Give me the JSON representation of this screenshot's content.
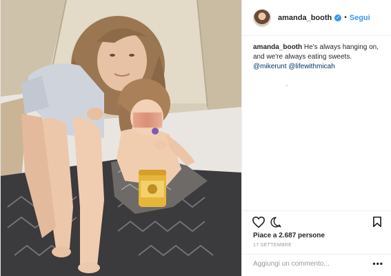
{
  "post": {
    "username": "amanda_booth",
    "follow_label": "Segui",
    "dot": "•",
    "verified_glyph": "✓",
    "caption": {
      "user": "amanda_booth",
      "text": "He's always hanging on, and we're always eating sweets.",
      "mentions": [
        "@mikerunt",
        "@lifewithmicah"
      ]
    },
    "likes_text": "Piace a 2.687 persone",
    "date_text": "17 SETTEMBRE",
    "comment_placeholder": "Aggiungi un commento...",
    "more_label": "•••"
  },
  "icons": [
    "heart-icon",
    "comment-icon",
    "bookmark-icon",
    "verified-badge-icon"
  ],
  "colors": {
    "link_blue": "#3897f0",
    "mention_blue": "#003569",
    "text": "#262626",
    "muted": "#999999",
    "border": "#efefef"
  }
}
